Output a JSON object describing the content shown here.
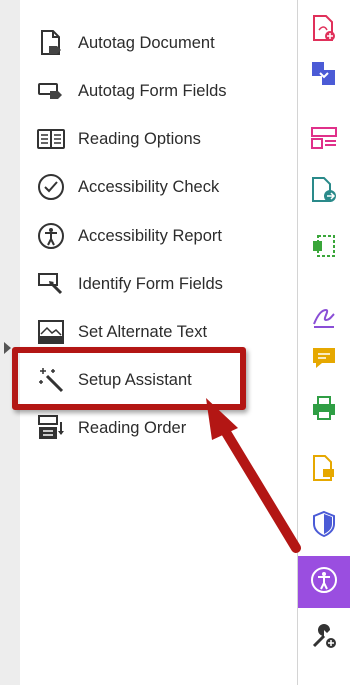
{
  "tools": [
    {
      "label": "Autotag Document",
      "icon": "autotag-document-icon"
    },
    {
      "label": "Autotag Form Fields",
      "icon": "autotag-form-fields-icon"
    },
    {
      "label": "Reading Options",
      "icon": "reading-options-icon"
    },
    {
      "label": "Accessibility Check",
      "icon": "accessibility-check-icon"
    },
    {
      "label": "Accessibility Report",
      "icon": "accessibility-report-icon"
    },
    {
      "label": "Identify Form Fields",
      "icon": "identify-form-fields-icon"
    },
    {
      "label": "Set Alternate Text",
      "icon": "set-alternate-text-icon"
    },
    {
      "label": "Setup Assistant",
      "icon": "setup-assistant-icon"
    },
    {
      "label": "Reading Order",
      "icon": "reading-order-icon"
    }
  ],
  "right_rail": [
    {
      "icon": "create-pdf-icon",
      "color": "#e0305a"
    },
    {
      "icon": "combine-files-icon",
      "color": "#4b5bd6"
    },
    {
      "icon": "organize-pages-icon",
      "color": "#e0308a"
    },
    {
      "icon": "export-pdf-icon",
      "color": "#2a8a8a"
    },
    {
      "icon": "scan-ocr-icon",
      "color": "#3aa63a"
    },
    {
      "icon": "fill-sign-icon",
      "color": "#8a4ed6"
    },
    {
      "icon": "comment-icon",
      "color": "#e6a800"
    },
    {
      "icon": "print-production-icon",
      "color": "#2f9e44"
    },
    {
      "icon": "send-comments-icon",
      "color": "#e6a800"
    },
    {
      "icon": "protect-icon",
      "color": "#4b5bd6"
    },
    {
      "icon": "accessibility-icon",
      "color": "#ffffff",
      "active": true
    },
    {
      "icon": "more-tools-icon",
      "color": "#333333"
    }
  ],
  "highlight_color": "#b31614",
  "active_color": "#9a4ee0"
}
